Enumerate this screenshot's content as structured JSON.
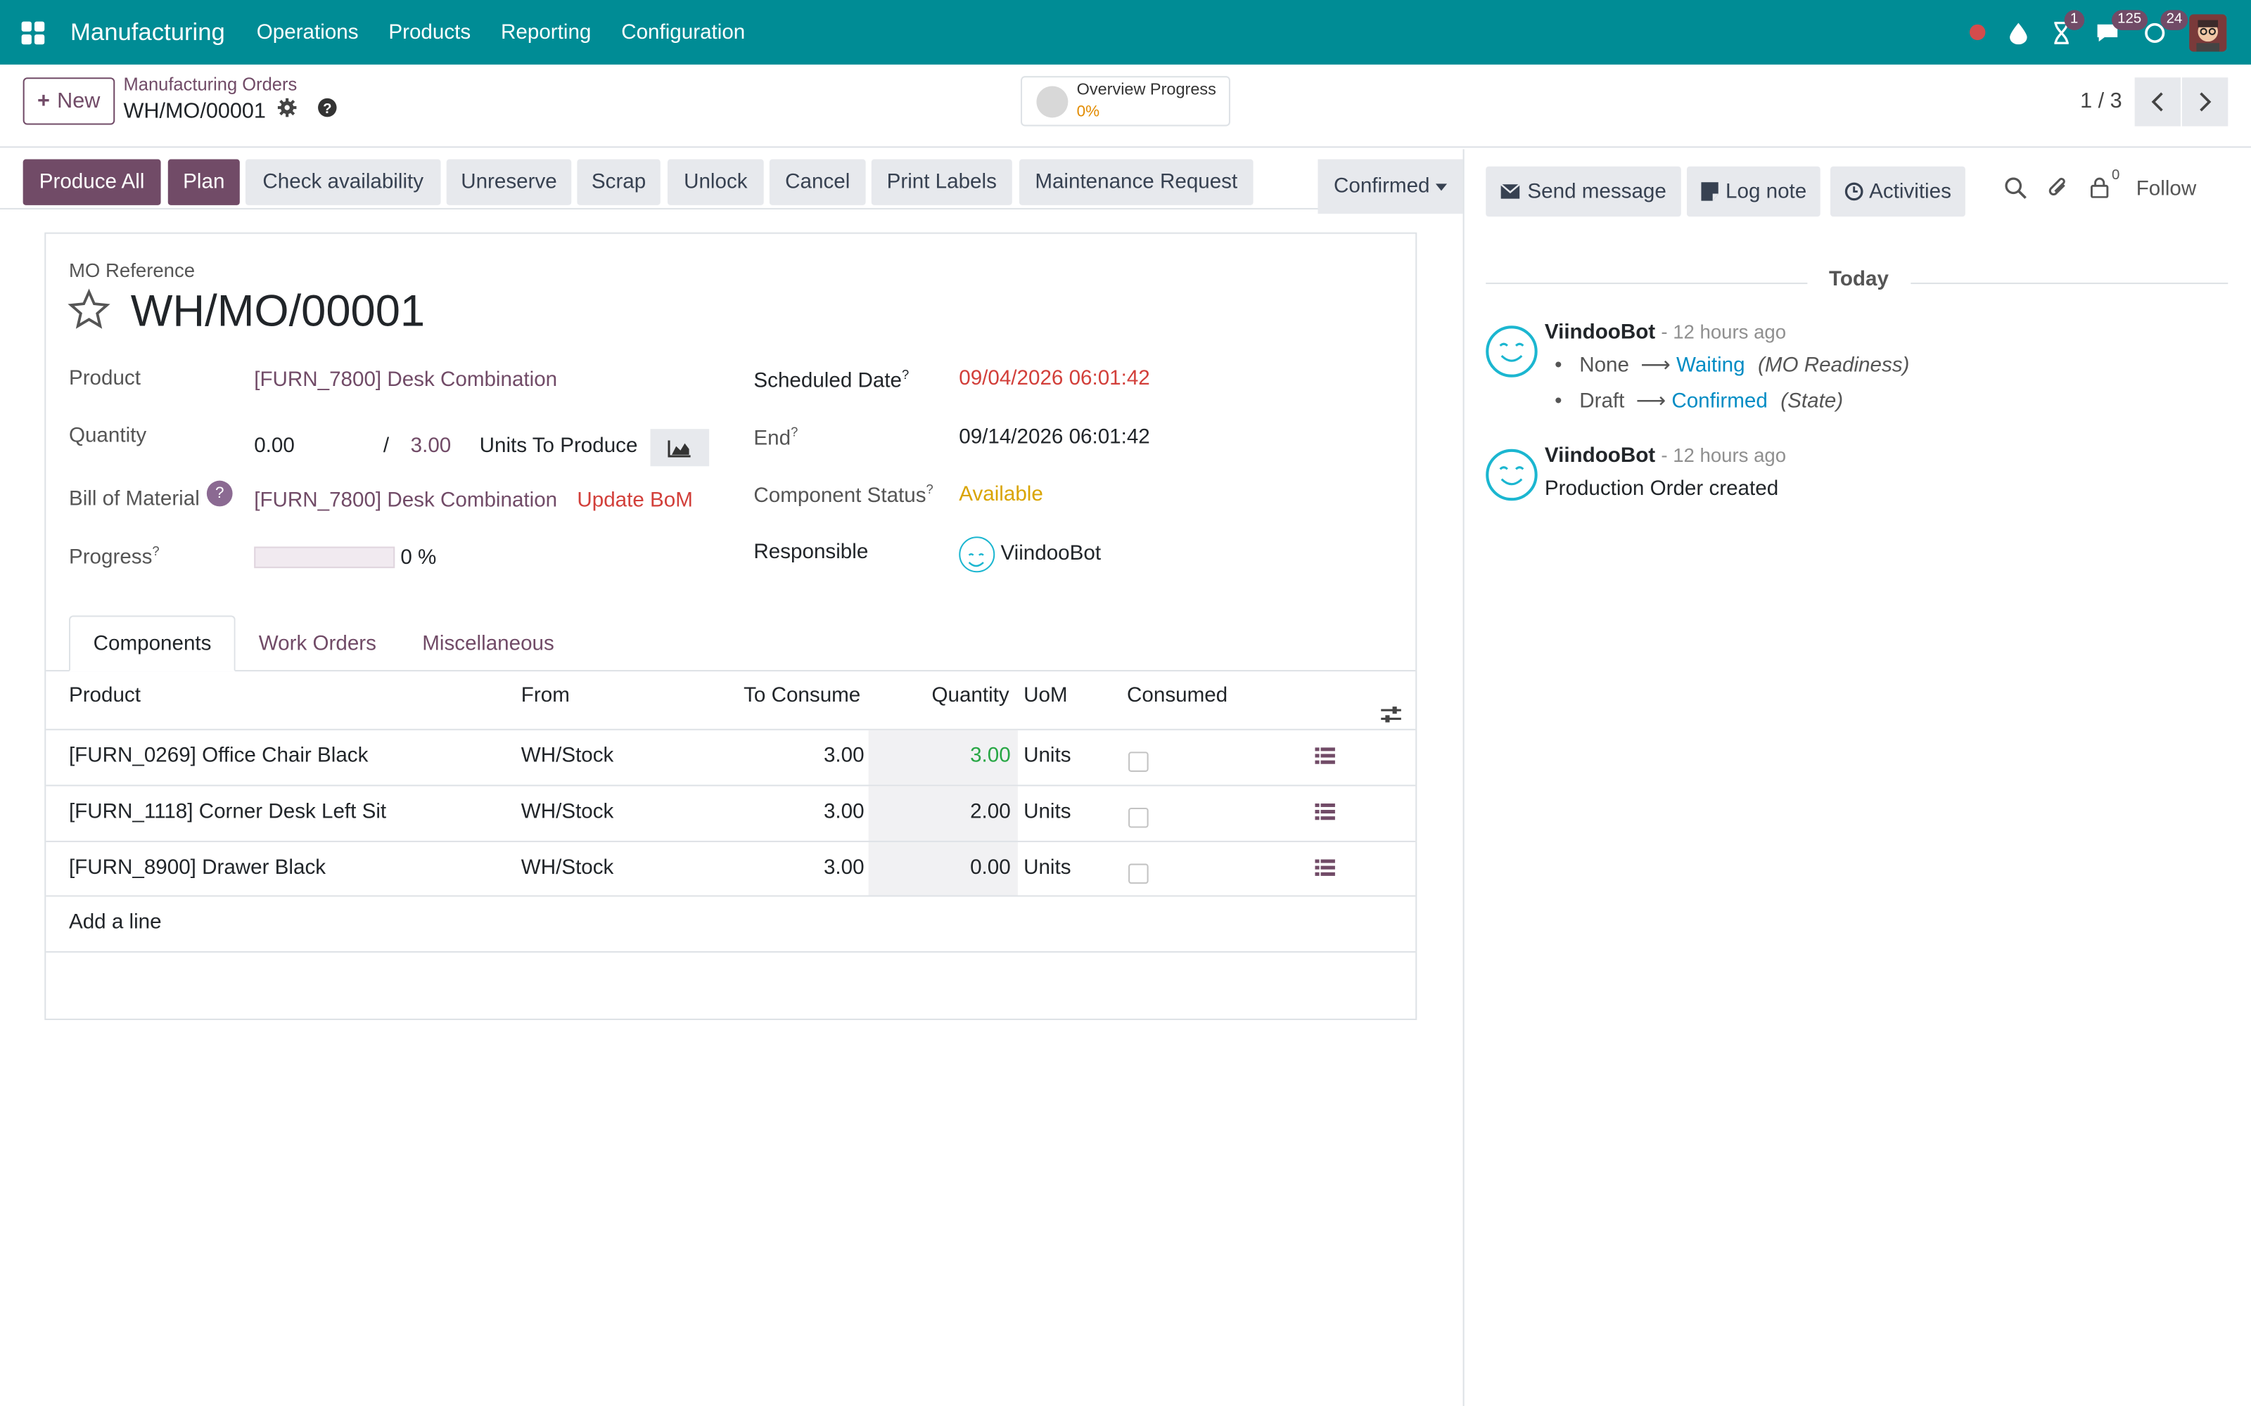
{
  "nav": {
    "brand": "Manufacturing",
    "menu": [
      "Operations",
      "Products",
      "Reporting",
      "Configuration"
    ],
    "badges": {
      "activity": "1",
      "messages": "125",
      "updates": "24"
    }
  },
  "control": {
    "new_label": "New",
    "breadcrumb_parent": "Manufacturing Orders",
    "breadcrumb_current": "WH/MO/00001",
    "overview_title": "Overview Progress",
    "overview_value": "0%",
    "pager": "1 / 3"
  },
  "statusbar": {
    "buttons": [
      "Produce All",
      "Plan",
      "Check availability",
      "Unreserve",
      "Scrap",
      "Unlock",
      "Cancel",
      "Print Labels",
      "Maintenance Request"
    ],
    "status": "Confirmed"
  },
  "form": {
    "ref_label": "MO Reference",
    "ref": "WH/MO/00001",
    "product_label": "Product",
    "product": "[FURN_7800] Desk Combination",
    "quantity_label": "Quantity",
    "qty_produced": "0.00",
    "qty_sep": "/",
    "qty_total": "3.00",
    "qty_unit": "Units To Produce",
    "bom_label": "Bill of Material",
    "bom": "[FURN_7800] Desk Combination",
    "update_bom": "Update BoM",
    "progress_label": "Progress",
    "progress_value": "0 %",
    "progress_fraction": 0,
    "scheduled_label": "Scheduled Date",
    "scheduled": "09/04/2026 06:01:42",
    "end_label": "End",
    "end": "09/14/2026 06:01:42",
    "comp_status_label": "Component Status",
    "comp_status": "Available",
    "responsible_label": "Responsible",
    "responsible": "ViindooBot",
    "help_mark": "?"
  },
  "tabs": [
    "Components",
    "Work Orders",
    "Miscellaneous"
  ],
  "table": {
    "headers": {
      "product": "Product",
      "from": "From",
      "to_consume": "To Consume",
      "quantity": "Quantity",
      "uom": "UoM",
      "consumed": "Consumed"
    },
    "rows": [
      {
        "product": "[FURN_0269] Office Chair Black",
        "from": "WH/Stock",
        "to_consume": "3.00",
        "quantity": "3.00",
        "uom": "Units"
      },
      {
        "product": "[FURN_1118] Corner Desk Left Sit",
        "from": "WH/Stock",
        "to_consume": "3.00",
        "quantity": "2.00",
        "uom": "Units"
      },
      {
        "product": "[FURN_8900] Drawer Black",
        "from": "WH/Stock",
        "to_consume": "3.00",
        "quantity": "0.00",
        "uom": "Units"
      }
    ],
    "add_line": "Add a line"
  },
  "chatter": {
    "send_message": "Send message",
    "log_note": "Log note",
    "activities": "Activities",
    "followers_count": "0",
    "follow": "Follow",
    "today": "Today",
    "messages": [
      {
        "author": "ViindooBot",
        "time": "- 12 hours ago",
        "changes": [
          {
            "from": "None",
            "to": "Waiting",
            "field": "(MO Readiness)"
          },
          {
            "from": "Draft",
            "to": "Confirmed",
            "field": "(State)"
          }
        ]
      },
      {
        "author": "ViindooBot",
        "time": "- 12 hours ago",
        "body": "Production Order created"
      }
    ]
  },
  "colors": {
    "nav": "#008c95",
    "primary": "#714b67",
    "link": "#008cc4",
    "danger": "#d23f3a",
    "warning": "#d9a400",
    "success": "#28a745"
  }
}
